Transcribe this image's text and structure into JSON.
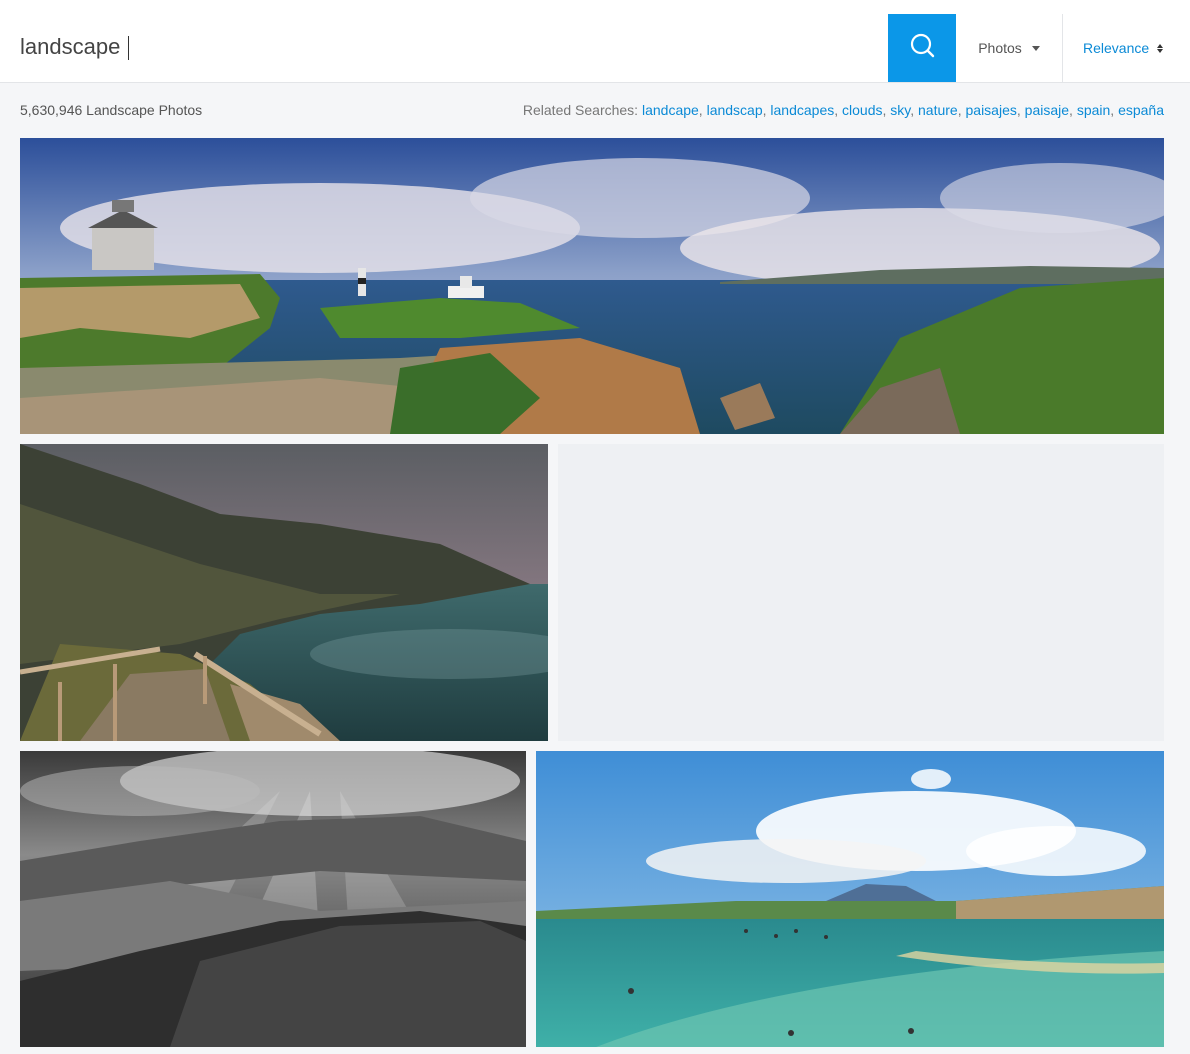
{
  "search": {
    "query": "landscape",
    "type_label": "Photos",
    "sort_label": "Relevance"
  },
  "results": {
    "count_text": "5,630,946 Landscape Photos",
    "related_label": "Related Searches:",
    "related": [
      "landcape",
      "landscap",
      "landcapes",
      "clouds",
      "sky",
      "nature",
      "paisajes",
      "paisaje",
      "spain",
      "españa"
    ]
  },
  "colors": {
    "accent": "#0b97e8",
    "link": "#0b8ad6",
    "placeholder": "#eef0f3"
  },
  "icons": {
    "search": "search-icon",
    "dropdown": "caret-down-icon",
    "sort": "sort-arrows-icon"
  }
}
